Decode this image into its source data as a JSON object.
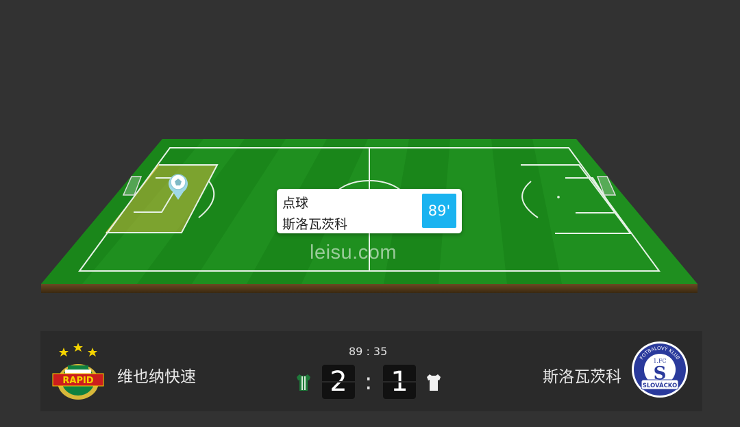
{
  "event": {
    "type": "点球",
    "team": "斯洛瓦茨科",
    "minute": "89'"
  },
  "watermark": "leisu.com",
  "match": {
    "clock": "89 : 35",
    "separator": ":",
    "home": {
      "name": "维也纳快速",
      "score": "2",
      "badge_text": "RAPID",
      "kit_color": "#1e7a3a"
    },
    "away": {
      "name": "斯洛瓦茨科",
      "score": "1",
      "badge_text": "SLOVÁCKO",
      "badge_top_text": "FOTBALOVÝ KLUB",
      "badge_mid_text": "1.FC",
      "badge_letter": "S",
      "kit_color": "#f2f2f2"
    }
  },
  "colors": {
    "pitch": "#1f8f1f",
    "highlight_zone": "#c8b43c",
    "event_minute_bg": "#1ab3f0"
  },
  "icons": {
    "event_marker": "football-pin-icon",
    "home_kit": "green-jersey-icon",
    "away_kit": "white-jersey-icon"
  }
}
